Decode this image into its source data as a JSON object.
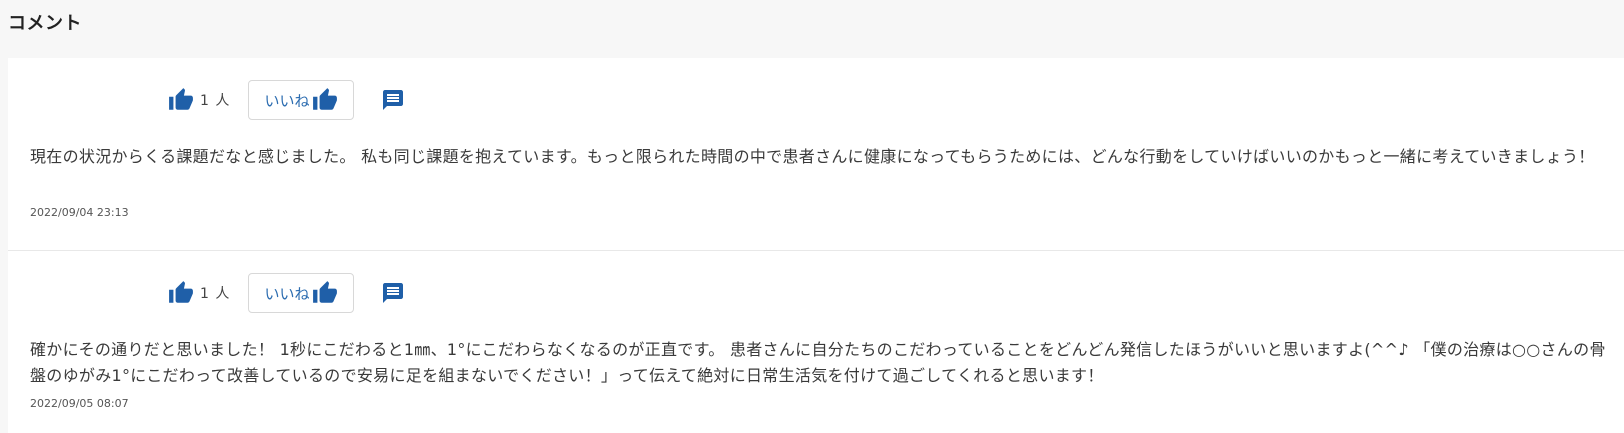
{
  "section": {
    "title": "コメント"
  },
  "comments": [
    {
      "like_count": "1 人",
      "like_label": "いいね",
      "text": "現在の状況からくる課題だなと感じました。 私も同じ課題を抱えています。もっと限られた時間の中で患者さんに健康になってもらうためには、どんな行動をしていけばいいのかもっと一緒に考えていきましょう！",
      "timestamp": "2022/09/04 23:13"
    },
    {
      "like_count": "1 人",
      "like_label": "いいね",
      "text": "確かにその通りだと思いました！ 1秒にこだわると1㎜、1°にこだわらなくなるのが正直です。 患者さんに自分たちのこだわっていることをどんどん発信したほうがいいと思いますよ(^^♪ 「僕の治療は○○さんの骨盤のゆがみ1°にこだわって改善しているので安易に足を組まないでください！」って伝えて絶対に日常生活気を付けて過ごしてくれると思います！",
      "timestamp": "2022/09/05 08:07"
    }
  ],
  "icons": {
    "thumb": "thumbs-up-icon",
    "comment": "comment-icon",
    "accent": "#1f5fa8"
  }
}
